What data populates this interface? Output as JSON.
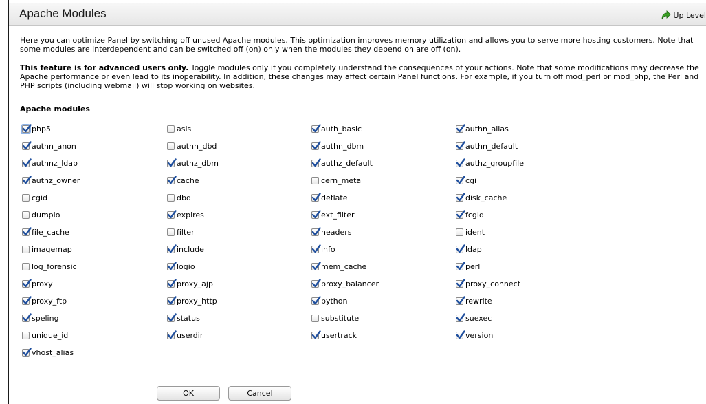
{
  "header": {
    "title": "Apache Modules",
    "up_level_label": "Up Level"
  },
  "intro": {
    "paragraph1": "Here you can optimize Panel by switching off unused Apache modules. This optimization improves memory utilization and allows you to serve more hosting customers. Note that some modules are interdependent and can be switched off (on) only when the modules they depend on are off (on).",
    "warning_bold": "This feature is for advanced users only.",
    "warning_text": " Toggle modules only if you completely understand the consequences of your actions. Note that some modifications may decrease the Apache performance or even lead to its inoperability. In addition, these changes may affect certain Panel functions. For example, if you turn off mod_perl or mod_php, the Perl and PHP scripts (including webmail) will stop working on websites."
  },
  "modules_section": {
    "legend": "Apache modules",
    "modules": [
      {
        "name": "php5",
        "checked": true
      },
      {
        "name": "asis",
        "checked": false
      },
      {
        "name": "auth_basic",
        "checked": true
      },
      {
        "name": "authn_alias",
        "checked": true
      },
      {
        "name": "authn_anon",
        "checked": true
      },
      {
        "name": "authn_dbd",
        "checked": false
      },
      {
        "name": "authn_dbm",
        "checked": true
      },
      {
        "name": "authn_default",
        "checked": true
      },
      {
        "name": "authnz_ldap",
        "checked": true
      },
      {
        "name": "authz_dbm",
        "checked": true
      },
      {
        "name": "authz_default",
        "checked": true
      },
      {
        "name": "authz_groupfile",
        "checked": true
      },
      {
        "name": "authz_owner",
        "checked": true
      },
      {
        "name": "cache",
        "checked": true
      },
      {
        "name": "cern_meta",
        "checked": false
      },
      {
        "name": "cgi",
        "checked": true
      },
      {
        "name": "cgid",
        "checked": false
      },
      {
        "name": "dbd",
        "checked": false
      },
      {
        "name": "deflate",
        "checked": true
      },
      {
        "name": "disk_cache",
        "checked": true
      },
      {
        "name": "dumpio",
        "checked": false
      },
      {
        "name": "expires",
        "checked": true
      },
      {
        "name": "ext_filter",
        "checked": true
      },
      {
        "name": "fcgid",
        "checked": true
      },
      {
        "name": "file_cache",
        "checked": true
      },
      {
        "name": "filter",
        "checked": false
      },
      {
        "name": "headers",
        "checked": true
      },
      {
        "name": "ident",
        "checked": false
      },
      {
        "name": "imagemap",
        "checked": false
      },
      {
        "name": "include",
        "checked": true
      },
      {
        "name": "info",
        "checked": true
      },
      {
        "name": "ldap",
        "checked": true
      },
      {
        "name": "log_forensic",
        "checked": false
      },
      {
        "name": "logio",
        "checked": true
      },
      {
        "name": "mem_cache",
        "checked": true
      },
      {
        "name": "perl",
        "checked": true
      },
      {
        "name": "proxy",
        "checked": true
      },
      {
        "name": "proxy_ajp",
        "checked": true
      },
      {
        "name": "proxy_balancer",
        "checked": true
      },
      {
        "name": "proxy_connect",
        "checked": true
      },
      {
        "name": "proxy_ftp",
        "checked": true
      },
      {
        "name": "proxy_http",
        "checked": true
      },
      {
        "name": "python",
        "checked": true
      },
      {
        "name": "rewrite",
        "checked": true
      },
      {
        "name": "speling",
        "checked": true
      },
      {
        "name": "status",
        "checked": true
      },
      {
        "name": "substitute",
        "checked": false
      },
      {
        "name": "suexec",
        "checked": true
      },
      {
        "name": "unique_id",
        "checked": false
      },
      {
        "name": "userdir",
        "checked": true
      },
      {
        "name": "usertrack",
        "checked": true
      },
      {
        "name": "version",
        "checked": true
      },
      {
        "name": "vhost_alias",
        "checked": true
      }
    ]
  },
  "buttons": {
    "ok_label": "OK",
    "cancel_label": "Cancel"
  },
  "colors": {
    "checkmark": "#1f4f9e",
    "up_level_icon": "#3aa023"
  }
}
